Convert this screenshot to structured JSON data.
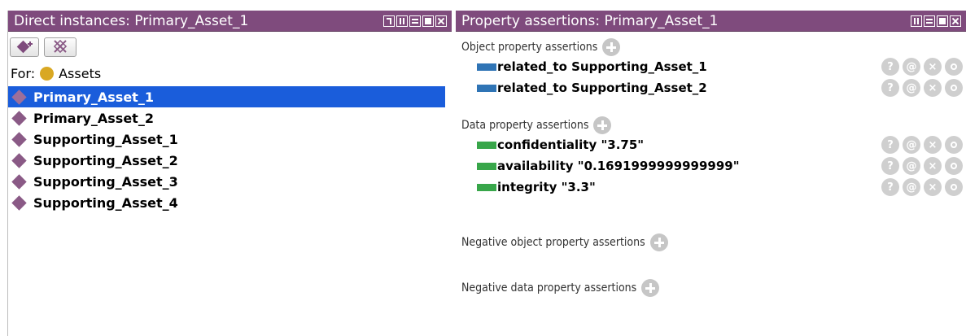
{
  "left_panel": {
    "title": "Direct instances: Primary_Asset_1",
    "for_label": "For:",
    "class_name": "Assets",
    "class_color": "#d9a823",
    "instances": [
      {
        "label": "Primary_Asset_1",
        "selected": true
      },
      {
        "label": "Primary_Asset_2",
        "selected": false
      },
      {
        "label": "Supporting_Asset_1",
        "selected": false
      },
      {
        "label": "Supporting_Asset_2",
        "selected": false
      },
      {
        "label": "Supporting_Asset_3",
        "selected": false
      },
      {
        "label": "Supporting_Asset_4",
        "selected": false
      }
    ]
  },
  "right_panel": {
    "title": "Property assertions: Primary_Asset_1",
    "object_section": {
      "header": "Object property assertions",
      "rows": [
        {
          "text": "related_to  Supporting_Asset_1"
        },
        {
          "text": "related_to  Supporting_Asset_2"
        }
      ]
    },
    "data_section": {
      "header": "Data property assertions",
      "rows": [
        {
          "text": "confidentiality  \"3.75\""
        },
        {
          "text": "availability  \"0.1691999999999999\""
        },
        {
          "text": "integrity  \"3.3\""
        }
      ]
    },
    "negative_object_header": "Negative object property assertions",
    "negative_data_header": "Negative data property assertions"
  },
  "row_actions": {
    "help": "?",
    "annotate": "@",
    "delete": "×"
  },
  "colors": {
    "title_bar": "#7f4b7d",
    "selection": "#1a5ddb",
    "object_property": "#2f74b5",
    "data_property": "#38a64a",
    "individual": "#8a5a86"
  }
}
